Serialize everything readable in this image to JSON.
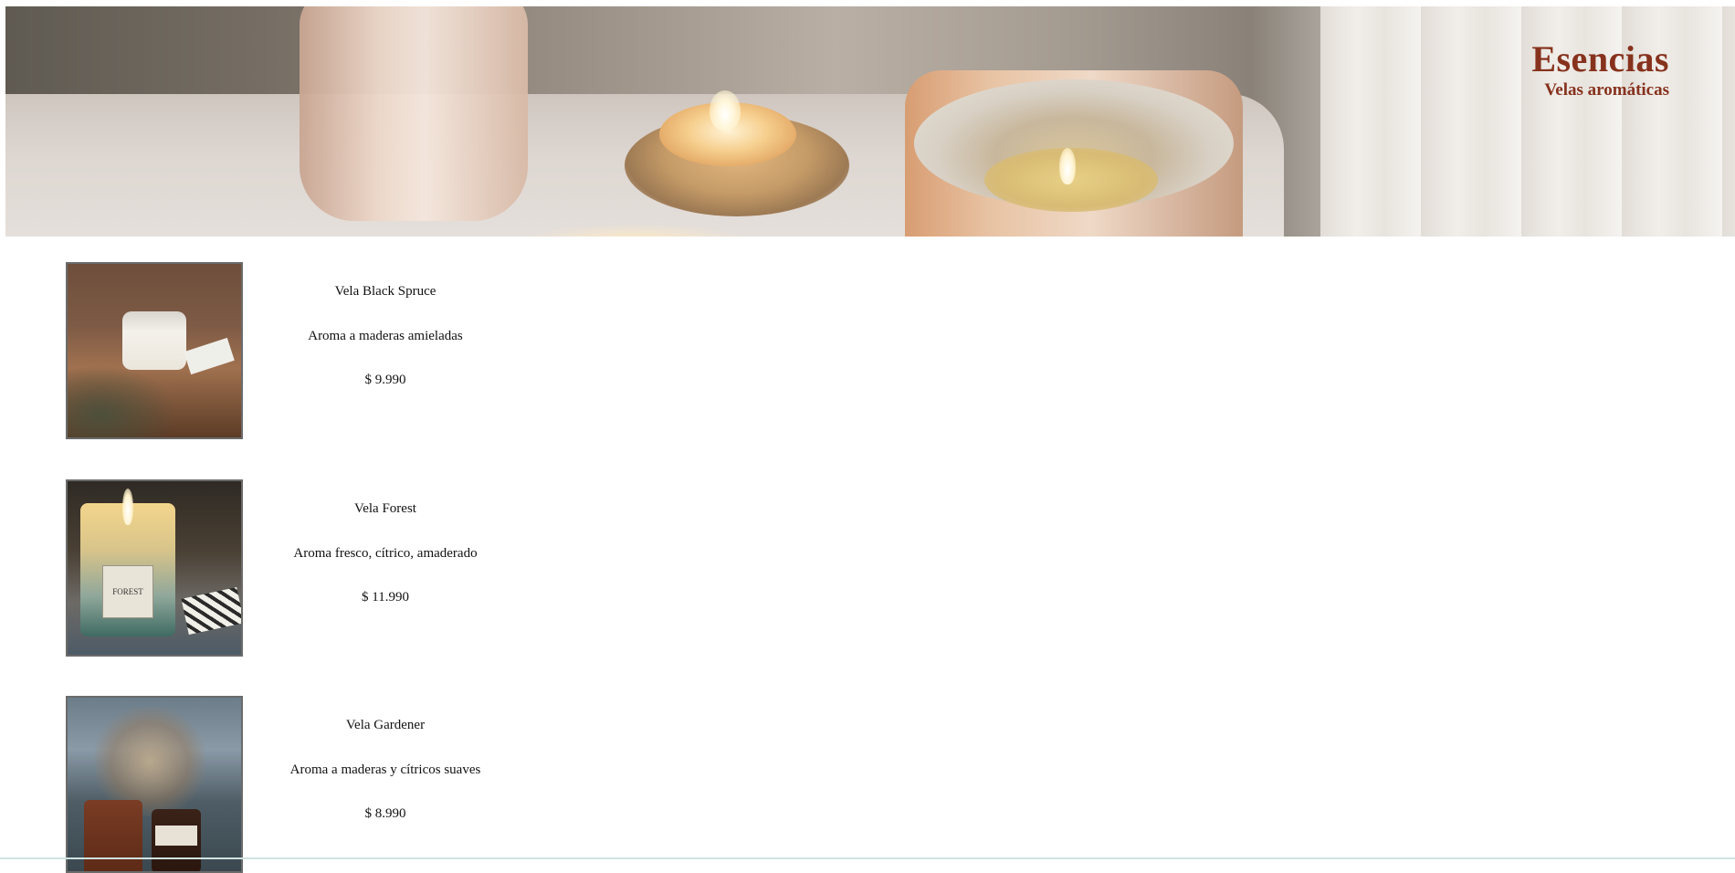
{
  "header": {
    "brand_name": "Esencias",
    "tagline": "Velas aromáticas",
    "brand_color": "#86321d"
  },
  "products": [
    {
      "name": "Vela Black Spruce",
      "description": "Aroma a maderas amieladas",
      "price": "$ 9.990"
    },
    {
      "name": "Vela Forest",
      "description": "Aroma fresco, cítrico, amaderado",
      "price": "$ 11.990",
      "jar_label": "FOREST"
    },
    {
      "name": "Vela Gardener",
      "description": "Aroma a maderas y cítricos suaves",
      "price": "$ 8.990"
    }
  ]
}
